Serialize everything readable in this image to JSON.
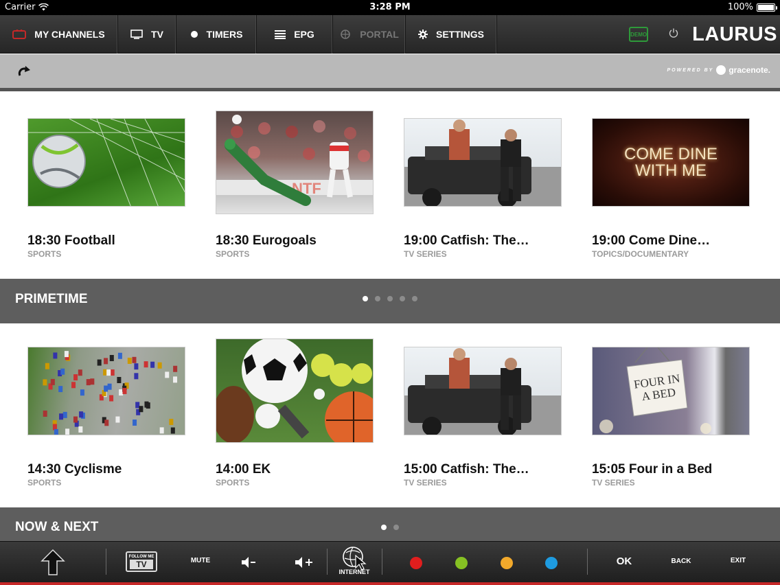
{
  "status_bar": {
    "carrier": "Carrier",
    "time": "3:28 PM",
    "battery": "100%"
  },
  "nav": {
    "items": [
      {
        "label": "MY CHANNELS",
        "icon": "tv-channels-icon"
      },
      {
        "label": "TV",
        "icon": "monitor-icon"
      },
      {
        "label": "TIMERS",
        "icon": "record-dot-icon"
      },
      {
        "label": "EPG",
        "icon": "list-icon"
      },
      {
        "label": "PORTAL",
        "icon": "portal-icon"
      },
      {
        "label": "SETTINGS",
        "icon": "gear-icon"
      }
    ],
    "demo_label": "DEMO",
    "logo": "LAURUS"
  },
  "toolbar": {
    "powered_by": "POWERED BY",
    "brand": "gracenote."
  },
  "sections": {
    "primetime": {
      "title": "PRIMETIME",
      "page_count": 5,
      "active_page": 0
    },
    "now_next": {
      "title": "NOW & NEXT",
      "page_count": 2,
      "active_page": 0
    }
  },
  "row1": [
    {
      "title": "18:30 Football",
      "category": "SPORTS"
    },
    {
      "title": "18:30 Eurogoals",
      "category": "SPORTS"
    },
    {
      "title": "19:00 Catfish: The…",
      "category": "TV SERIES"
    },
    {
      "title": "19:00 Come Dine…",
      "category": "TOPICS/DOCUMENTARY",
      "thumb_text": "COME DINE WITH ME"
    }
  ],
  "row2": [
    {
      "title": "14:30 Cyclisme",
      "category": "SPORTS"
    },
    {
      "title": "14:00 EK",
      "category": "SPORTS"
    },
    {
      "title": "15:00 Catfish: The…",
      "category": "TV SERIES"
    },
    {
      "title": "15:05 Four in a Bed",
      "category": "TV SERIES",
      "thumb_text": "FOUR IN A BED"
    }
  ],
  "bottom": {
    "follow_me_top": "FOLLOW ME",
    "follow_me_bottom": "TV",
    "mute": "MUTE",
    "internet": "INTERNET",
    "ok": "OK",
    "back": "BACK",
    "exit": "EXIT",
    "colors": [
      "#e01e1e",
      "#86c123",
      "#f2a92b",
      "#1e9be0"
    ]
  }
}
